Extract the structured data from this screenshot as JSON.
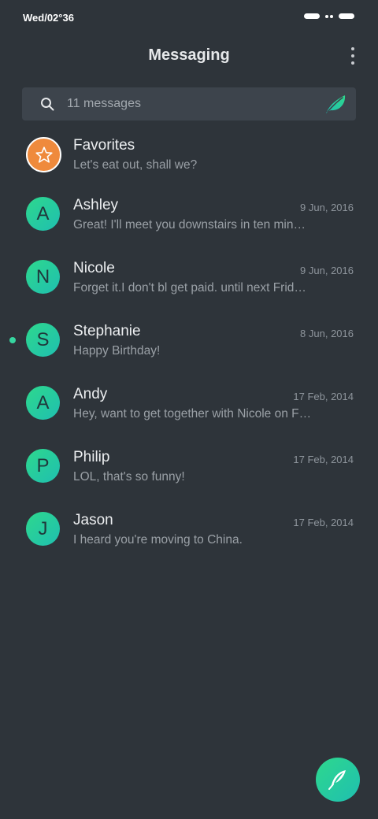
{
  "status_bar": {
    "time": "Wed/02°36"
  },
  "header": {
    "title": "Messaging"
  },
  "search": {
    "placeholder": "11 messages",
    "value": ""
  },
  "conversations": [
    {
      "initial": "★",
      "name": "Favorites",
      "date": "",
      "preview": "Let's eat out, shall we?",
      "unread": false,
      "avatar_color": "#ef8a3c"
    },
    {
      "initial": "A",
      "name": "Ashley",
      "date": "9 Jun, 2016",
      "preview": "Great! I'll meet you downstairs in ten min…",
      "unread": false
    },
    {
      "initial": "N",
      "name": "Nicole",
      "date": "9 Jun, 2016",
      "preview": "Forget it.I don't bl get paid. until next Frid…",
      "unread": false
    },
    {
      "initial": "S",
      "name": "Stephanie",
      "date": "8 Jun, 2016",
      "preview": "Happy Birthday!",
      "unread": true
    },
    {
      "initial": "A",
      "name": "Andy",
      "date": "17 Feb, 2014",
      "preview": "Hey, want to get together with Nicole on F…",
      "unread": false
    },
    {
      "initial": "P",
      "name": "Philip",
      "date": "17 Feb, 2014",
      "preview": "LOL, that's so funny!",
      "unread": false
    },
    {
      "initial": "J",
      "name": "Jason",
      "date": "17 Feb, 2014",
      "preview": "I heard you're moving to China.",
      "unread": false
    }
  ],
  "colors": {
    "background": "#2e343a",
    "search_bg": "#3d444c",
    "accent_start": "#2ed88d",
    "accent_end": "#1fbfb0",
    "favorites": "#ef8a3c",
    "unread_dot": "#36d6a0"
  },
  "icons": {
    "search": "search-icon",
    "leaf": "leaf-icon",
    "more": "more-vertical-icon",
    "star": "star-icon",
    "compose": "feather-icon"
  }
}
